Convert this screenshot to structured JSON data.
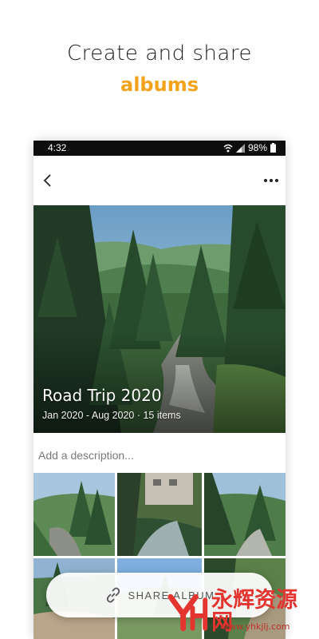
{
  "promo": {
    "title": "Create and share",
    "accent": "albums",
    "accent_color": "#f3a21b"
  },
  "status_bar": {
    "time": "4:32",
    "battery": "98%"
  },
  "app_bar": {
    "back_icon": "chevron-left-icon",
    "more_icon": "more-horizontal-icon"
  },
  "album": {
    "title": "Road Trip 2020",
    "meta": "Jan 2020 - Aug 2020 · 15 items",
    "description_placeholder": "Add a description..."
  },
  "photos": [
    {
      "label": "forest-creek"
    },
    {
      "label": "street-creek"
    },
    {
      "label": "river-pines"
    },
    {
      "label": "lake-trees"
    },
    {
      "label": "mountain-sky"
    },
    {
      "label": "forest-path"
    }
  ],
  "share_button": {
    "label": "SHARE ALBUM",
    "icon": "link-icon"
  },
  "watermark": {
    "text": "永辉资源网",
    "url": "www.yhkjlj.com"
  }
}
